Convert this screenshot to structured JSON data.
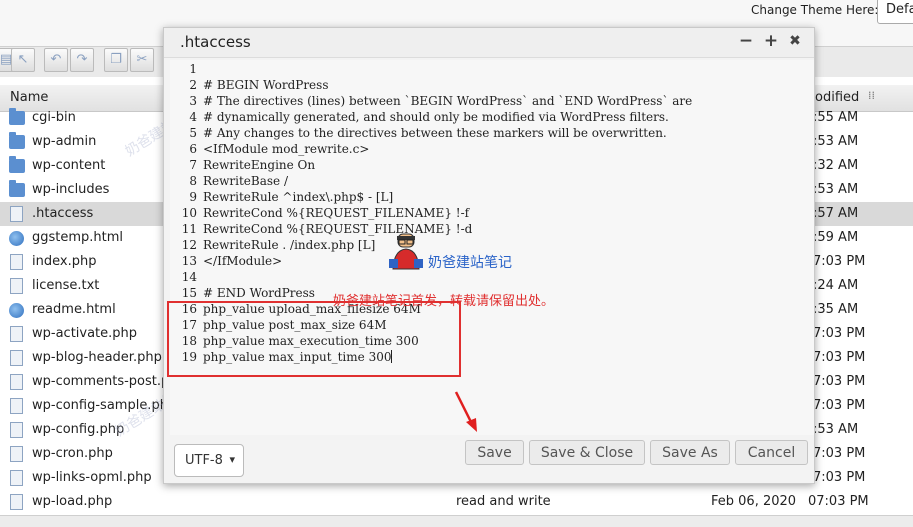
{
  "topbar": {
    "theme_label": "Change Theme Here:",
    "theme_value": "Defa"
  },
  "columns": {
    "name": "Name",
    "modified": "odified"
  },
  "files": [
    {
      "name": "cgi-bin",
      "type": "folder",
      "perm": "",
      "date": "",
      "time": ":55 AM"
    },
    {
      "name": "wp-admin",
      "type": "folder",
      "perm": "",
      "date": "",
      "time": ":53 AM"
    },
    {
      "name": "wp-content",
      "type": "folder",
      "perm": "",
      "date": "",
      "time": ":32 AM"
    },
    {
      "name": "wp-includes",
      "type": "folder",
      "perm": "",
      "date": "",
      "time": ":53 AM"
    },
    {
      "name": ".htaccess",
      "type": "file",
      "perm": "",
      "date": "",
      "time": ":57 AM",
      "selected": true
    },
    {
      "name": "ggstemp.html",
      "type": "globe",
      "perm": "",
      "date": "",
      "time": ":59 AM"
    },
    {
      "name": "index.php",
      "type": "file",
      "perm": "",
      "date": "",
      "time": "7:03 PM"
    },
    {
      "name": "license.txt",
      "type": "file",
      "perm": "",
      "date": "",
      "time": ":24 AM"
    },
    {
      "name": "readme.html",
      "type": "globe",
      "perm": "",
      "date": "",
      "time": ":35 AM"
    },
    {
      "name": "wp-activate.php",
      "type": "file",
      "perm": "",
      "date": "",
      "time": "7:03 PM"
    },
    {
      "name": "wp-blog-header.php",
      "type": "file",
      "perm": "",
      "date": "",
      "time": "7:03 PM"
    },
    {
      "name": "wp-comments-post.p",
      "type": "file",
      "perm": "",
      "date": "",
      "time": "7:03 PM"
    },
    {
      "name": "wp-config-sample.ph",
      "type": "file",
      "perm": "",
      "date": "",
      "time": "7:03 PM"
    },
    {
      "name": "wp-config.php",
      "type": "file",
      "perm": "",
      "date": "",
      "time": ":53 AM"
    },
    {
      "name": "wp-cron.php",
      "type": "file",
      "perm": "",
      "date": "",
      "time": "7:03 PM"
    },
    {
      "name": "wp-links-opml.php",
      "type": "file",
      "perm": "",
      "date": "",
      "time": "7:03 PM"
    },
    {
      "name": "wp-load.php",
      "type": "file",
      "perm": "read and write",
      "date": "Feb 06, 2020",
      "time": "07:03 PM"
    }
  ],
  "dialog": {
    "title": ".htaccess",
    "controls": {
      "minimize": "−",
      "maximize": "+",
      "close": "✖"
    },
    "lines": [
      {
        "n": "1",
        "text": ""
      },
      {
        "n": "2",
        "text": "# BEGIN WordPress"
      },
      {
        "n": "3",
        "text": "# The directives (lines) between `BEGIN WordPress` and `END WordPress` are"
      },
      {
        "n": "4",
        "text": "# dynamically generated, and should only be modified via WordPress filters."
      },
      {
        "n": "5",
        "text": "# Any changes to the directives between these markers will be overwritten."
      },
      {
        "n": "6",
        "text": "<IfModule mod_rewrite.c>"
      },
      {
        "n": "7",
        "text": "RewriteEngine On"
      },
      {
        "n": "8",
        "text": "RewriteBase /"
      },
      {
        "n": "9",
        "text": "RewriteRule ^index\\.php$ - [L]"
      },
      {
        "n": "10",
        "text": "RewriteCond %{REQUEST_FILENAME} !-f"
      },
      {
        "n": "11",
        "text": "RewriteCond %{REQUEST_FILENAME} !-d"
      },
      {
        "n": "12",
        "text": "RewriteRule . /index.php [L]"
      },
      {
        "n": "13",
        "text": "</IfModule>"
      },
      {
        "n": "14",
        "text": ""
      },
      {
        "n": "15",
        "text": "# END WordPress"
      },
      {
        "n": "16",
        "text": "php_value upload_max_filesize 64M"
      },
      {
        "n": "17",
        "text": "php_value post_max_size 64M"
      },
      {
        "n": "18",
        "text": "php_value max_execution_time 300"
      },
      {
        "n": "19",
        "text": "php_value max_input_time 300"
      }
    ],
    "encoding": "UTF-8",
    "buttons": {
      "save": "Save",
      "save_close": "Save & Close",
      "save_as": "Save As",
      "cancel": "Cancel"
    }
  },
  "watermark": {
    "brand": "奶爸建站笔记",
    "notice": "奶爸建站笔记首发，转载请保留出处。"
  },
  "colors": {
    "highlight_box": "#e03030",
    "brand_blue": "#2a63c8",
    "folder": "#5b8fd0"
  }
}
